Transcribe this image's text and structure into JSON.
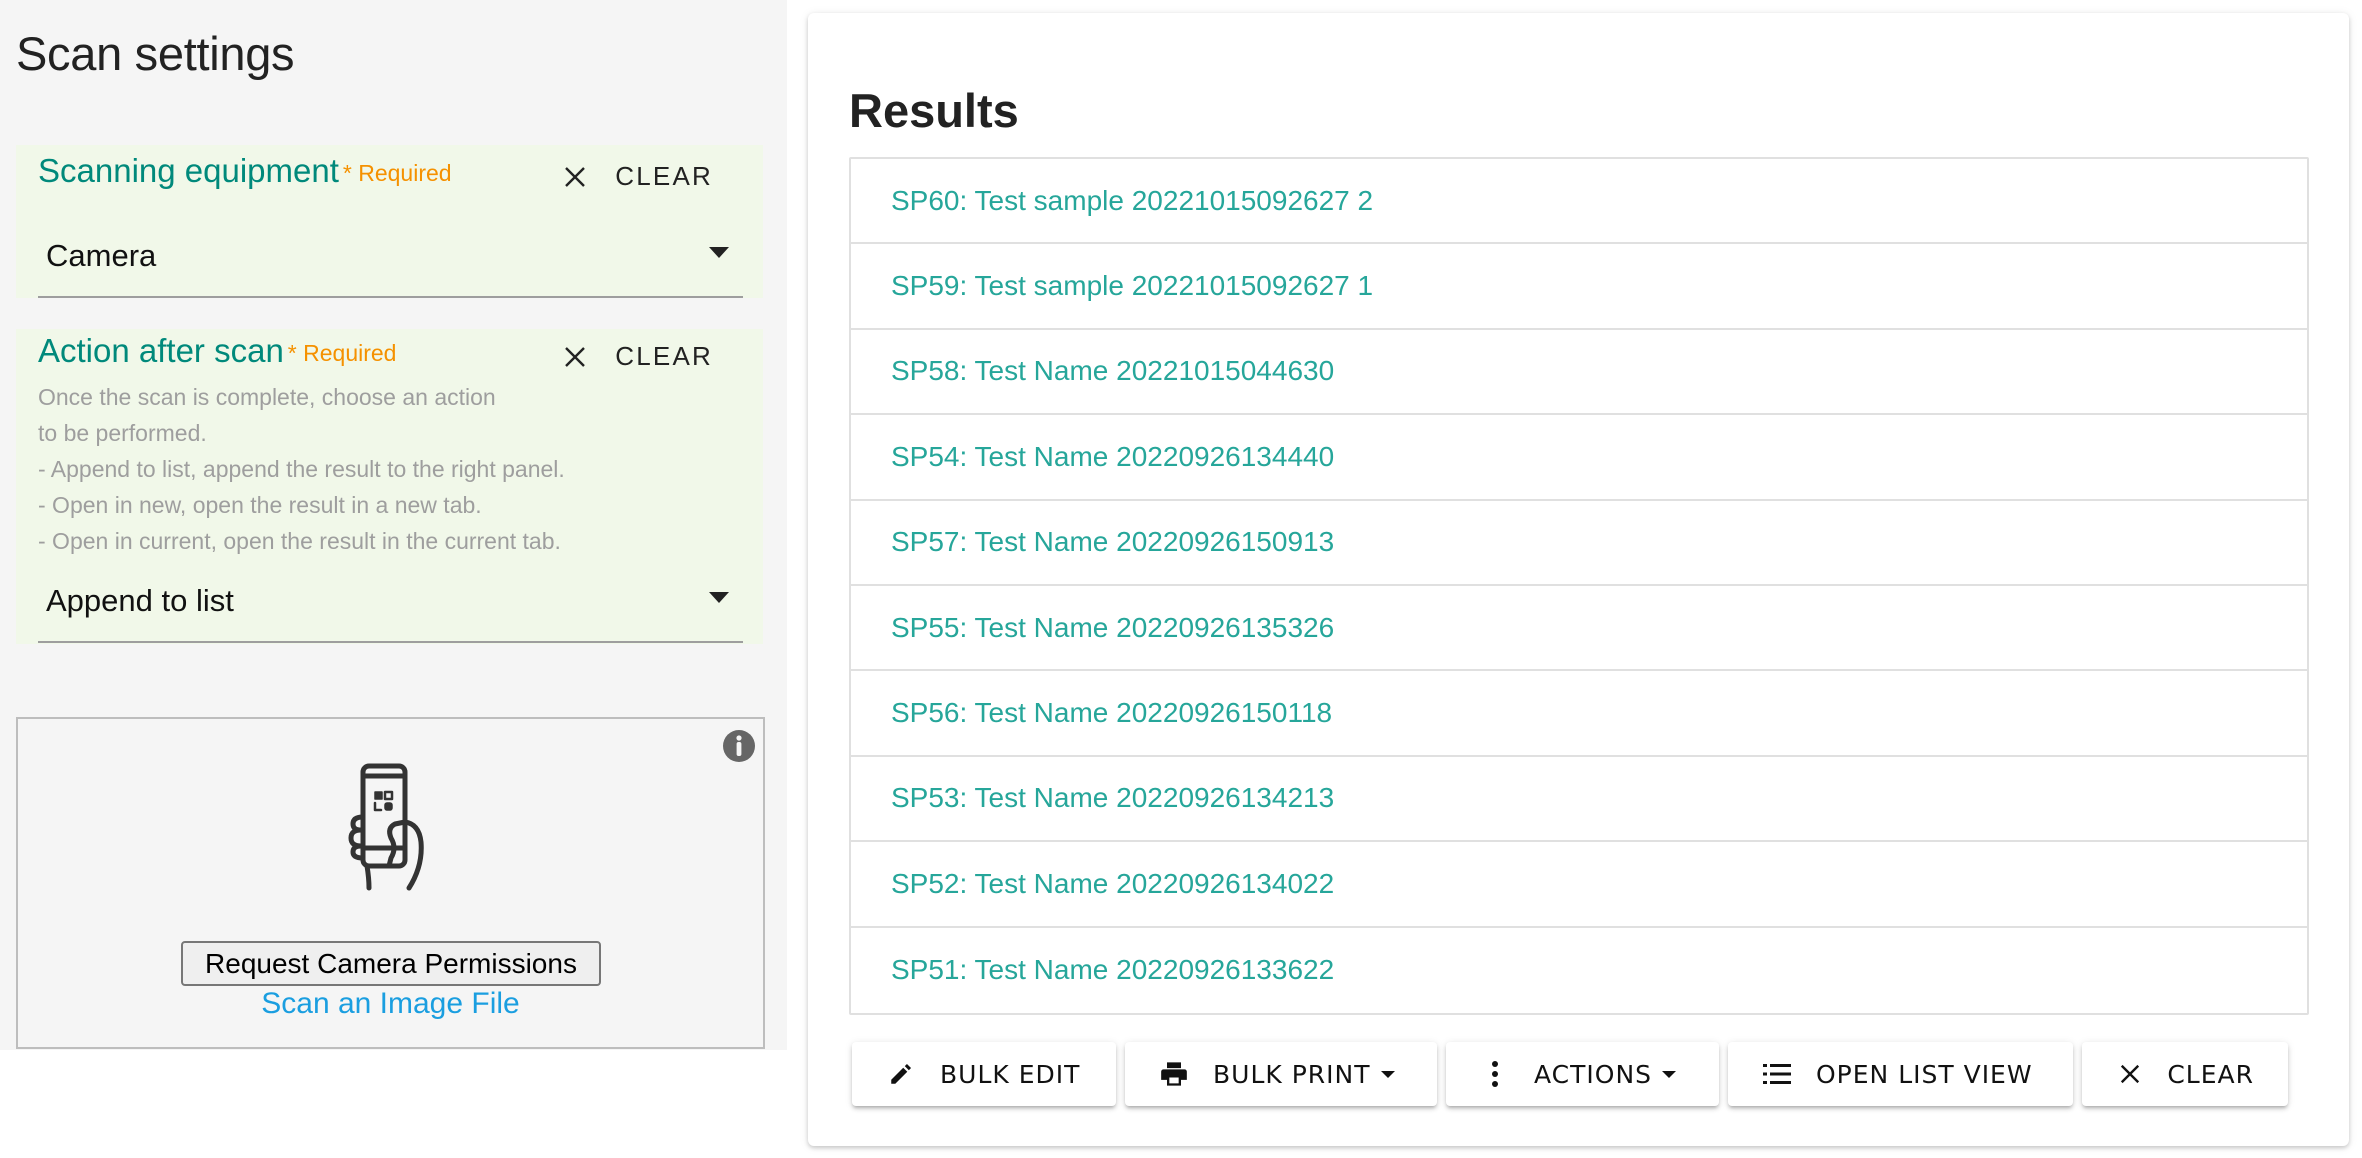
{
  "left": {
    "title": "Scan settings",
    "scanning_equipment": {
      "label": "Scanning equipment",
      "required": "* Required",
      "clear_label": "CLEAR",
      "value": "Camera"
    },
    "action_after_scan": {
      "label": "Action after scan",
      "required": "* Required",
      "clear_label": "CLEAR",
      "help": [
        "Once the scan is complete, choose an action",
        "to be performed.",
        "- Append to list, append the result to the right panel.",
        "- Open in new, open the result in a new tab.",
        "- Open in current, open the result in the current tab."
      ],
      "value": "Append to list"
    },
    "scanner": {
      "info_icon": "info-icon",
      "illustration": "phone-scan-icon",
      "permission_button": "Request Camera Permissions",
      "scan_file_link": "Scan an Image File"
    }
  },
  "results": {
    "title": "Results",
    "items": [
      "SP60: Test sample 20221015092627 2",
      "SP59: Test sample 20221015092627 1",
      "SP58: Test Name 20221015044630",
      "SP54: Test Name 20220926134440",
      "SP57: Test Name 20220926150913",
      "SP55: Test Name 20220926135326",
      "SP56: Test Name 20220926150118",
      "SP53: Test Name 20220926134213",
      "SP52: Test Name 20220926134022",
      "SP51: Test Name 20220926133622"
    ],
    "buttons": {
      "bulk_edit": "BULK EDIT",
      "bulk_print": "BULK PRINT",
      "actions": "ACTIONS",
      "open_list_view": "OPEN LIST VIEW",
      "clear": "CLEAR"
    }
  },
  "colors": {
    "accent": "#00897b",
    "link": "#26a69a",
    "required": "#f59100",
    "field_bg": "#f1f8e9",
    "file_link": "#1a9ee0"
  }
}
